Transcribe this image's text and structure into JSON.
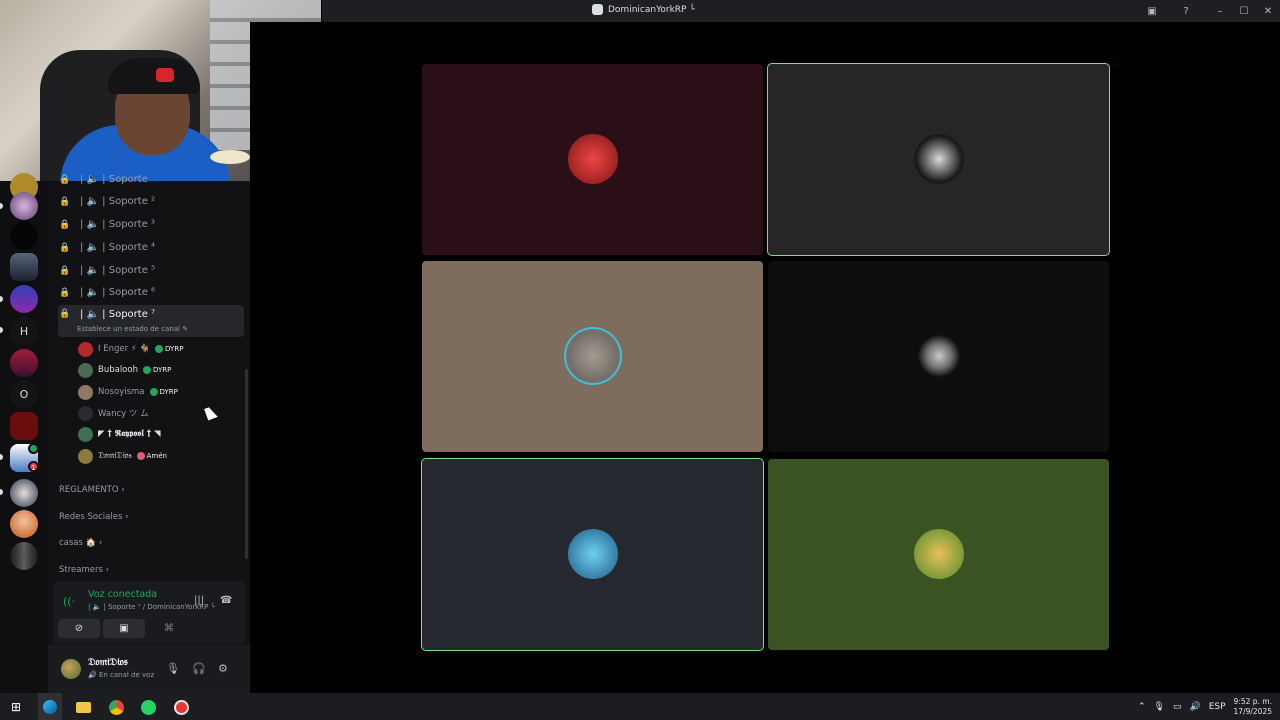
{
  "window": {
    "title": "DominicanYorkRP └"
  },
  "titlebar_icons": [
    "screen-share-icon",
    "help-icon",
    "minimize-icon",
    "maximize-icon",
    "close-icon"
  ],
  "channels": [
    {
      "label": "| 🔈 | Soporte ²"
    },
    {
      "label": "| 🔈 | Soporte ³"
    },
    {
      "label": "| 🔈 | Soporte ⁴"
    },
    {
      "label": "| 🔈 | Soporte ⁵"
    },
    {
      "label": "| 🔈 | Soporte ⁶"
    },
    {
      "label": "| 🔈 | Soporte ⁷"
    }
  ],
  "channel_top_partial": "| 🔈 | Soporte",
  "channel_status_note": "Establece un estado de canal ✎",
  "voice_users": [
    {
      "name": "I Enger ⚡ 🐐",
      "tag": "DYRP",
      "av": "#b22a2a"
    },
    {
      "name": "Bubalooh",
      "tag": "DYRP",
      "av": "#4a6b4f"
    },
    {
      "name": "Nosoyisma",
      "tag": "DYRP",
      "av": "#8c7a62"
    },
    {
      "name": "Wancy ツ ム",
      "tag": "",
      "av": "#2a2b30"
    },
    {
      "name": "◤ † 𝕽𝖆𝖞𝖕𝖔𝖔𝖑 † ◥",
      "tag": "",
      "av": "#3d6e56"
    },
    {
      "name": "𝔇𝔬𝔪𝔦𝔇𝔦𝔬𝔰",
      "tag": "Amén",
      "av": "#8b7a3c"
    }
  ],
  "categories": [
    "REGLAMENTO",
    "Redes Sociales",
    "casas 🏠",
    "Streamers"
  ],
  "voice": {
    "title": "Voz conectada",
    "subtitle": "| 🔈 | Soporte ⁷ / DominicanYorkRP └"
  },
  "user": {
    "name": "𝔇𝔬𝔪𝔦𝔇𝔦𝔬𝔰",
    "status": "🔊 En canal de voz"
  },
  "server_rail": {
    "letters": [
      "H",
      "O"
    ],
    "badge_count": "1"
  },
  "tiles": [
    {
      "bg": "#2a0f17",
      "avatar": "#c42a2a",
      "speaking": false
    },
    {
      "bg": "#262629",
      "avatar": "#3b3b3e",
      "speaking": true
    },
    {
      "bg": "#7e6d5c",
      "avatar": "#5c5a58",
      "speaking": false,
      "ring": true
    },
    {
      "bg": "#0c0f0e",
      "avatar": "#a9aba9",
      "speaking": false
    },
    {
      "bg": "#25282e",
      "avatar": "#2f8fc4",
      "speaking": true
    },
    {
      "bg": "#3b5323",
      "avatar": "#c9722a",
      "speaking": false
    }
  ],
  "taskbar": {
    "lang": "ESP",
    "time": "9:52 p. m.",
    "date": "17/9/2025"
  }
}
